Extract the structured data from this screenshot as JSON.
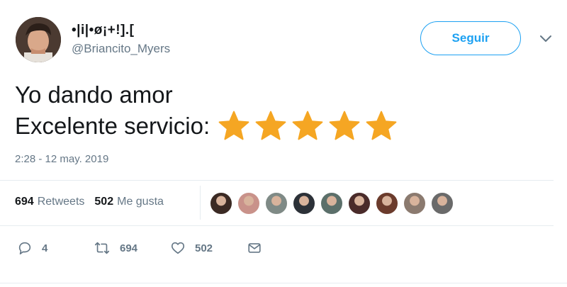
{
  "user": {
    "display_name": "•|i|•ø¡+!].[",
    "handle": "@Briancito_Myers"
  },
  "follow_button_label": "Seguir",
  "tweet": {
    "line1": "Yo dando amor",
    "line2": "Excelente servicio:",
    "stars": 5,
    "timestamp": "2:28 - 12 may. 2019"
  },
  "stats": {
    "retweets_count": "694",
    "retweets_label": "Retweets",
    "likes_count": "502",
    "likes_label": "Me gusta"
  },
  "likers": [
    "#3b2a24",
    "#c9928a",
    "#7f8a86",
    "#2c3138",
    "#5b6f6a",
    "#4a2b2a",
    "#6b3b2c",
    "#8b7a6f",
    "#6a6a6a"
  ],
  "actions": {
    "reply_count": "4",
    "retweet_count": "694",
    "like_count": "502"
  },
  "colors": {
    "accent": "#1da1f2",
    "star": "#f5a623",
    "muted": "#657786"
  }
}
